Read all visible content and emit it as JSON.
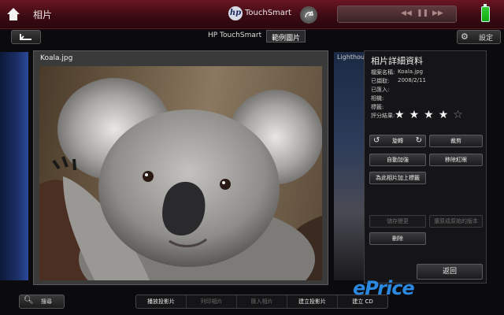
{
  "topbar": {
    "app_title": "相片",
    "hp_logo_text": "hp",
    "brand": "TouchSmart",
    "media_controls": [
      "◀◀",
      "❚❚",
      "▶▶"
    ]
  },
  "nav": {
    "breadcrumbs": [
      {
        "label": "HP TouchSmart",
        "active": false
      },
      {
        "label": "範例圖片",
        "active": true
      }
    ],
    "settings_label": "設定"
  },
  "photos": {
    "current": "Koala.jpg",
    "next": "Lighthouse.jpg"
  },
  "details": {
    "title": "相片詳細資料",
    "fields": [
      {
        "label": "檔案名稱:",
        "value": "Koala.jpg"
      },
      {
        "label": "已擷取:",
        "value": "2008/2/11"
      },
      {
        "label": "已匯入:",
        "value": ""
      },
      {
        "label": "相機:",
        "value": ""
      },
      {
        "label": "標籤:",
        "value": ""
      },
      {
        "label": "評分結果:",
        "value": ""
      }
    ],
    "rating": 4,
    "rating_max": 5,
    "buttons": {
      "rotate": "旋轉",
      "crop": "裁剪",
      "auto_enhance": "自動加強",
      "remove_redeye": "移除紅眼",
      "add_tag": "為此相片加上標籤",
      "save_changes": "儲存變更",
      "restore_original": "還原成原始的版本",
      "delete": "刪除",
      "back": "返回"
    }
  },
  "bottom": {
    "search_label": "搜尋",
    "actions": [
      {
        "label": "播放投影片",
        "enabled": true
      },
      {
        "label": "列印相片",
        "enabled": false
      },
      {
        "label": "匯入相片",
        "enabled": false
      },
      {
        "label": "建立投影片",
        "enabled": true
      },
      {
        "label": "建立 CD",
        "enabled": true
      }
    ]
  },
  "watermark": "ePrice"
}
